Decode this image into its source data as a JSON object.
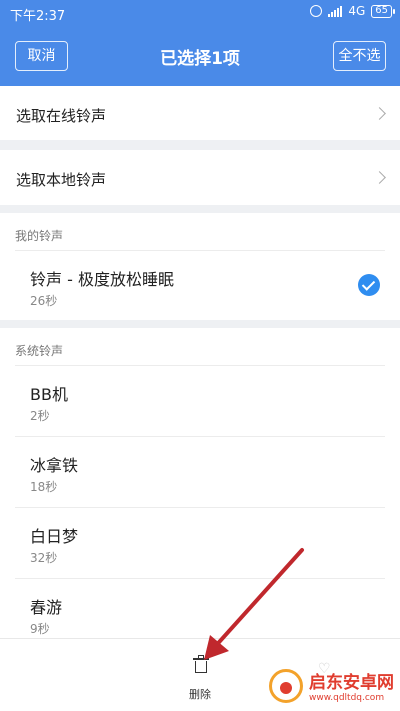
{
  "status_bar": {
    "time": "下午2:37",
    "network": "4G",
    "battery": "65"
  },
  "header": {
    "cancel_label": "取消",
    "title": "已选择1项",
    "deselect_all_label": "全不选"
  },
  "links": [
    {
      "label": "选取在线铃声"
    },
    {
      "label": "选取本地铃声"
    }
  ],
  "my_ringtones": {
    "header": "我的铃声",
    "items": [
      {
        "name": "铃声 - 极度放松睡眠",
        "duration": "26秒",
        "selected": true
      }
    ]
  },
  "system_ringtones": {
    "header": "系统铃声",
    "items": [
      {
        "name": "BB机",
        "duration": "2秒"
      },
      {
        "name": "冰拿铁",
        "duration": "18秒"
      },
      {
        "name": "白日梦",
        "duration": "32秒"
      },
      {
        "name": "春游",
        "duration": "9秒"
      }
    ]
  },
  "bottom_bar": {
    "delete_label": "删除"
  },
  "watermark": {
    "title": "启东安卓网",
    "url": "www.qdltdq.com"
  },
  "colors": {
    "header_bg": "#4a8ae8",
    "check": "#2f8df0",
    "arrow": "#c0282d"
  },
  "icons": [
    "alarm-icon",
    "signal-icon",
    "battery-icon",
    "chevron-right-icon",
    "check-icon",
    "trash-icon",
    "heart-icon"
  ]
}
